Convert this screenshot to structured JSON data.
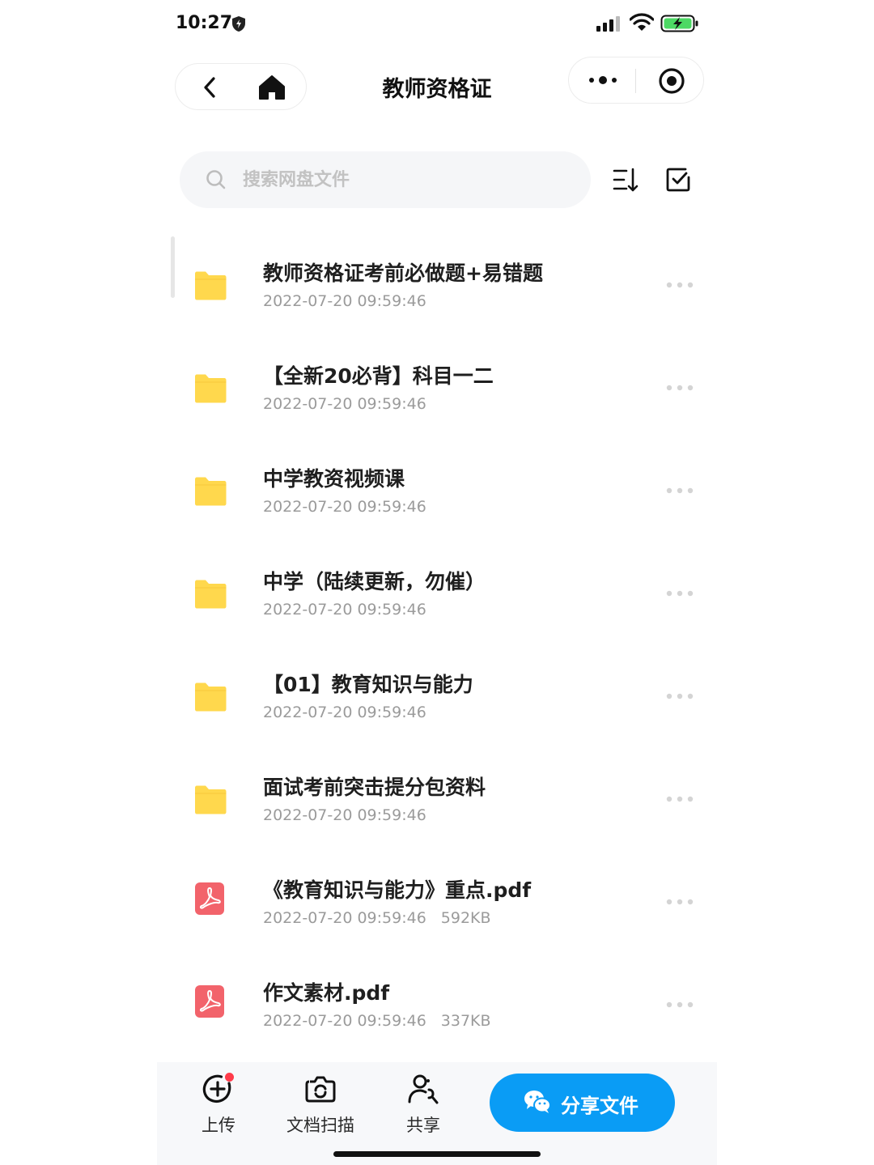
{
  "status_bar": {
    "time": "10:27"
  },
  "nav": {
    "title": "教师资格证"
  },
  "search": {
    "placeholder": "搜索网盘文件"
  },
  "files": [
    {
      "name": "教师资格证考前必做题+易错题",
      "date": "2022-07-20 09:59:46",
      "size": "",
      "type": "folder",
      "icon": "folder-icon"
    },
    {
      "name": "【全新20必背】科目一二",
      "date": "2022-07-20 09:59:46",
      "size": "",
      "type": "folder",
      "icon": "folder-icon"
    },
    {
      "name": "中学教资视频课",
      "date": "2022-07-20 09:59:46",
      "size": "",
      "type": "folder",
      "icon": "folder-icon"
    },
    {
      "name": "中学（陆续更新，勿催）",
      "date": "2022-07-20 09:59:46",
      "size": "",
      "type": "folder",
      "icon": "folder-icon"
    },
    {
      "name": "【01】教育知识与能力",
      "date": "2022-07-20 09:59:46",
      "size": "",
      "type": "folder",
      "icon": "folder-icon"
    },
    {
      "name": "面试考前突击提分包资料",
      "date": "2022-07-20 09:59:46",
      "size": "",
      "type": "folder",
      "icon": "folder-icon"
    },
    {
      "name": "《教育知识与能力》重点.pdf",
      "date": "2022-07-20 09:59:46",
      "size": "592KB",
      "type": "pdf",
      "icon": "pdf-icon"
    },
    {
      "name": "作文素材.pdf",
      "date": "2022-07-20 09:59:46",
      "size": "337KB",
      "type": "pdf",
      "icon": "pdf-icon"
    }
  ],
  "toolbar": {
    "upload_label": "上传",
    "scan_label": "文档扫描",
    "share_label": "共享",
    "share_file_label": "分享文件"
  },
  "colors": {
    "accent": "#0a9cf5",
    "folder": "#ffd84d",
    "pdf": "#f2636b",
    "badge": "#ff3b4a"
  }
}
